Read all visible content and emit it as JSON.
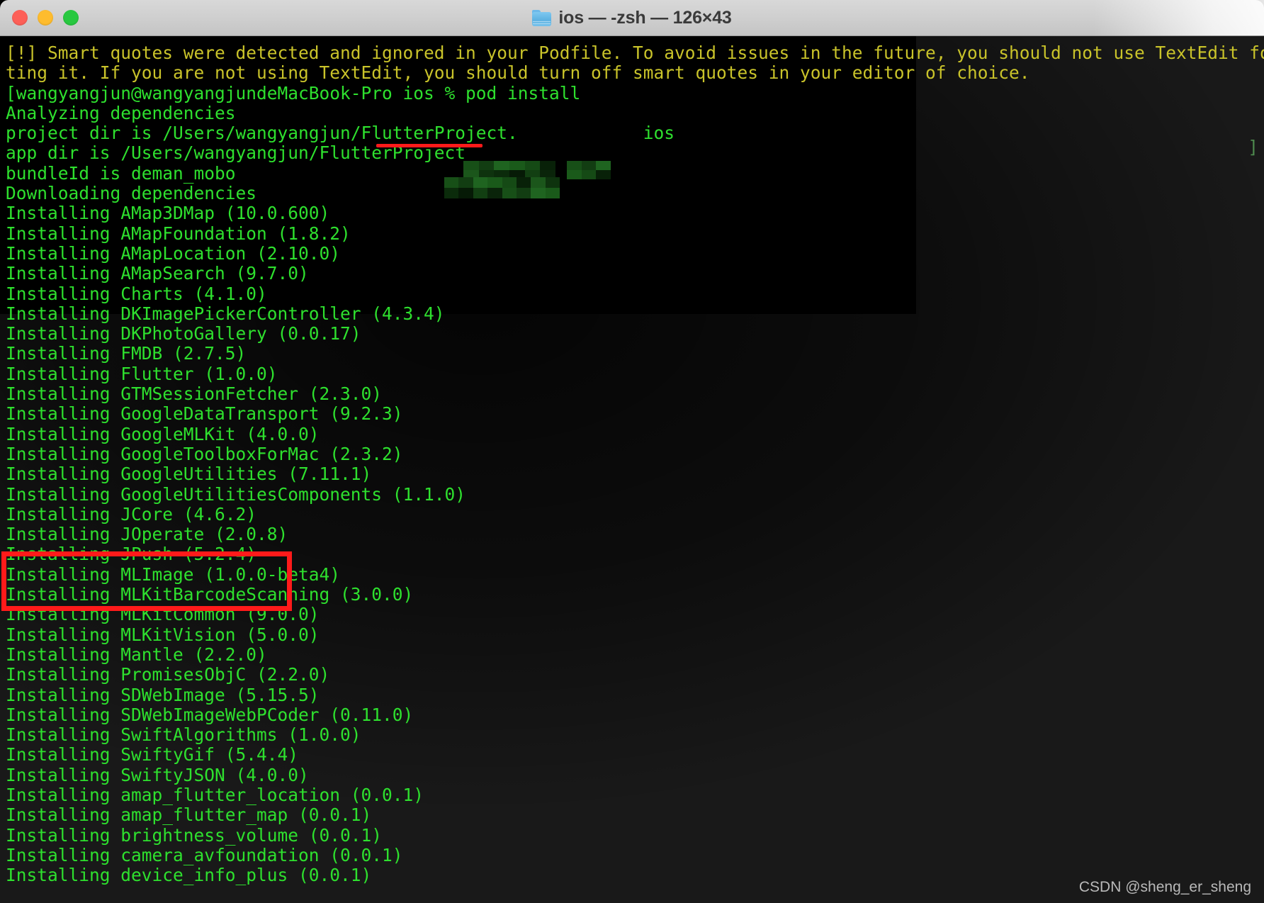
{
  "window": {
    "title": "ios — -zsh — 126×43",
    "folder_icon": "folder-icon",
    "traffic_lights": {
      "close": "close-button",
      "minimize": "minimize-button",
      "maximize": "maximize-button"
    }
  },
  "colors": {
    "prompt_green": "#2ee02e",
    "warning_yellow": "#c9c32a",
    "annotation_red": "#ff1a1a",
    "terminal_bg": "#1c1c1c",
    "titlebar_bg": "#cfcfcf"
  },
  "terminal": {
    "warning": {
      "line1": "[!] Smart quotes were detected and ignored in your Podfile. To avoid issues in the future, you should not use TextEdit for edi",
      "line2": "ting it. If you are not using TextEdit, you should turn off smart quotes in your editor of choice."
    },
    "prompt": {
      "full": "wangyangjun@wangyangjundeMacBook-Pro ios % pod install",
      "user_host_path": "wangyangjun@wangyangjundeMacBook-Pro ios % ",
      "command": "pod install",
      "leading_bracket": "[",
      "trailing_bracket": "]"
    },
    "output": {
      "analyzing": "Analyzing dependencies",
      "project_dir_prefix": "project dir is /Users/wangyangjun/FlutterProject.",
      "project_dir_suffix": "ios",
      "app_dir_prefix": "app dir is /Users/wangyangjun/FlutterProject",
      "bundle_id": "bundleId is deman_mobo",
      "downloading": "Downloading dependencies"
    },
    "installs": [
      "Installing AMap3DMap (10.0.600)",
      "Installing AMapFoundation (1.8.2)",
      "Installing AMapLocation (2.10.0)",
      "Installing AMapSearch (9.7.0)",
      "Installing Charts (4.1.0)",
      "Installing DKImagePickerController (4.3.4)",
      "Installing DKPhotoGallery (0.0.17)",
      "Installing FMDB (2.7.5)",
      "Installing Flutter (1.0.0)",
      "Installing GTMSessionFetcher (2.3.0)",
      "Installing GoogleDataTransport (9.2.3)",
      "Installing GoogleMLKit (4.0.0)",
      "Installing GoogleToolboxForMac (2.3.2)",
      "Installing GoogleUtilities (7.11.1)",
      "Installing GoogleUtilitiesComponents (1.1.0)",
      "Installing JCore (4.6.2)",
      "Installing JOperate (2.0.8)",
      "Installing JPush (5.2.4)",
      "Installing MLImage (1.0.0-beta4)",
      "Installing MLKitBarcodeScanning (3.0.0)",
      "Installing MLKitCommon (9.0.0)",
      "Installing MLKitVision (5.0.0)",
      "Installing Mantle (2.2.0)",
      "Installing PromisesObjC (2.2.0)",
      "Installing SDWebImage (5.15.5)",
      "Installing SDWebImageWebPCoder (0.11.0)",
      "Installing SwiftAlgorithms (1.0.0)",
      "Installing SwiftyGif (5.4.4)",
      "Installing SwiftyJSON (4.0.0)",
      "Installing amap_flutter_location (0.0.1)",
      "Installing amap_flutter_map (0.0.1)",
      "Installing brightness_volume (0.0.1)",
      "Installing camera_avfoundation (0.0.1)",
      "Installing device_info_plus (0.0.1)"
    ],
    "annotations": {
      "command_underline": "pod install",
      "highlighted_packages": [
        "Installing JCore (4.6.2)",
        "Installing JOperate (2.0.8)",
        "Installing JPush (5.2.4)"
      ]
    }
  },
  "watermark": "CSDN @sheng_er_sheng"
}
